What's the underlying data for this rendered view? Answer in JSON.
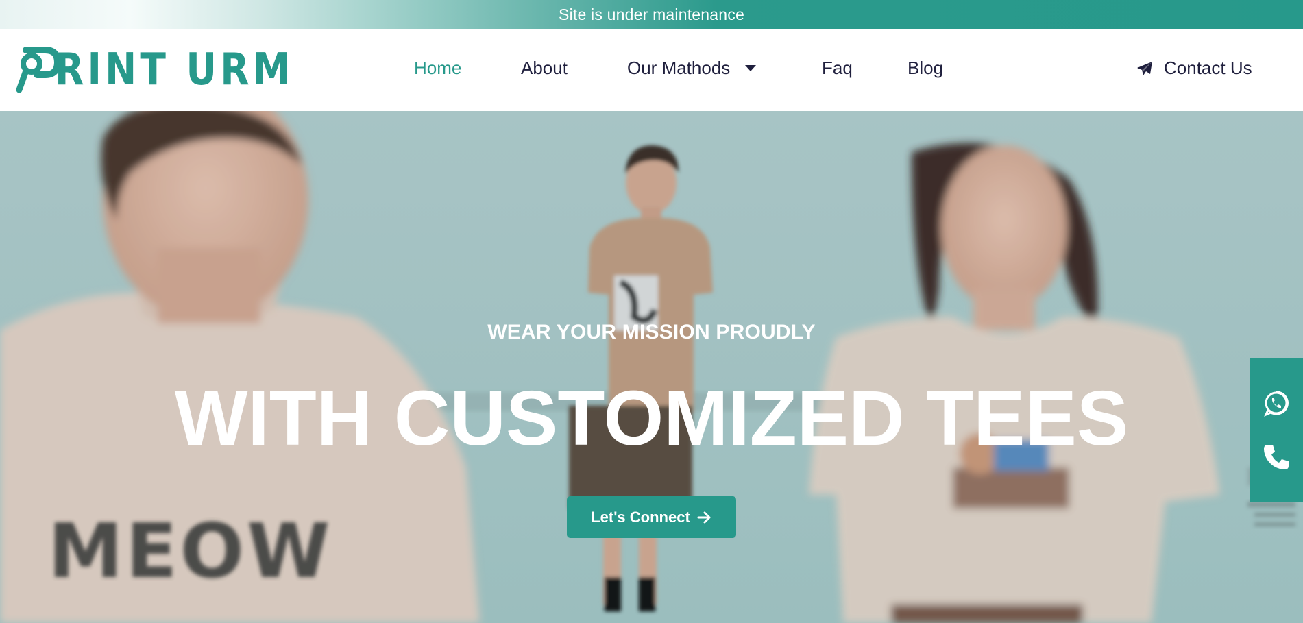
{
  "announcement": {
    "text": "Site is under maintenance"
  },
  "header": {
    "logo_text": "RINT URM",
    "nav": [
      {
        "label": "Home",
        "active": true
      },
      {
        "label": "About",
        "active": false
      },
      {
        "label": "Our Mathods",
        "active": false,
        "has_dropdown": true
      },
      {
        "label": "Faq",
        "active": false
      },
      {
        "label": "Blog",
        "active": false
      }
    ],
    "contact_label": "Contact Us",
    "contact_icon": "paper-plane-icon"
  },
  "hero": {
    "subtitle": "WEAR YOUR MISSION PROUDLY",
    "title": "WITH CUSTOMIZED TEES",
    "cta_label": "Let's Connect",
    "cta_icon": "arrow-right-icon",
    "shirt_print": "MEOW"
  },
  "floating_widget": {
    "icons": [
      "whatsapp-icon",
      "phone-icon"
    ]
  },
  "colors": {
    "brand": "#27998b",
    "nav_text": "#1f1f3d",
    "hero_bg": "#bad6d6"
  }
}
